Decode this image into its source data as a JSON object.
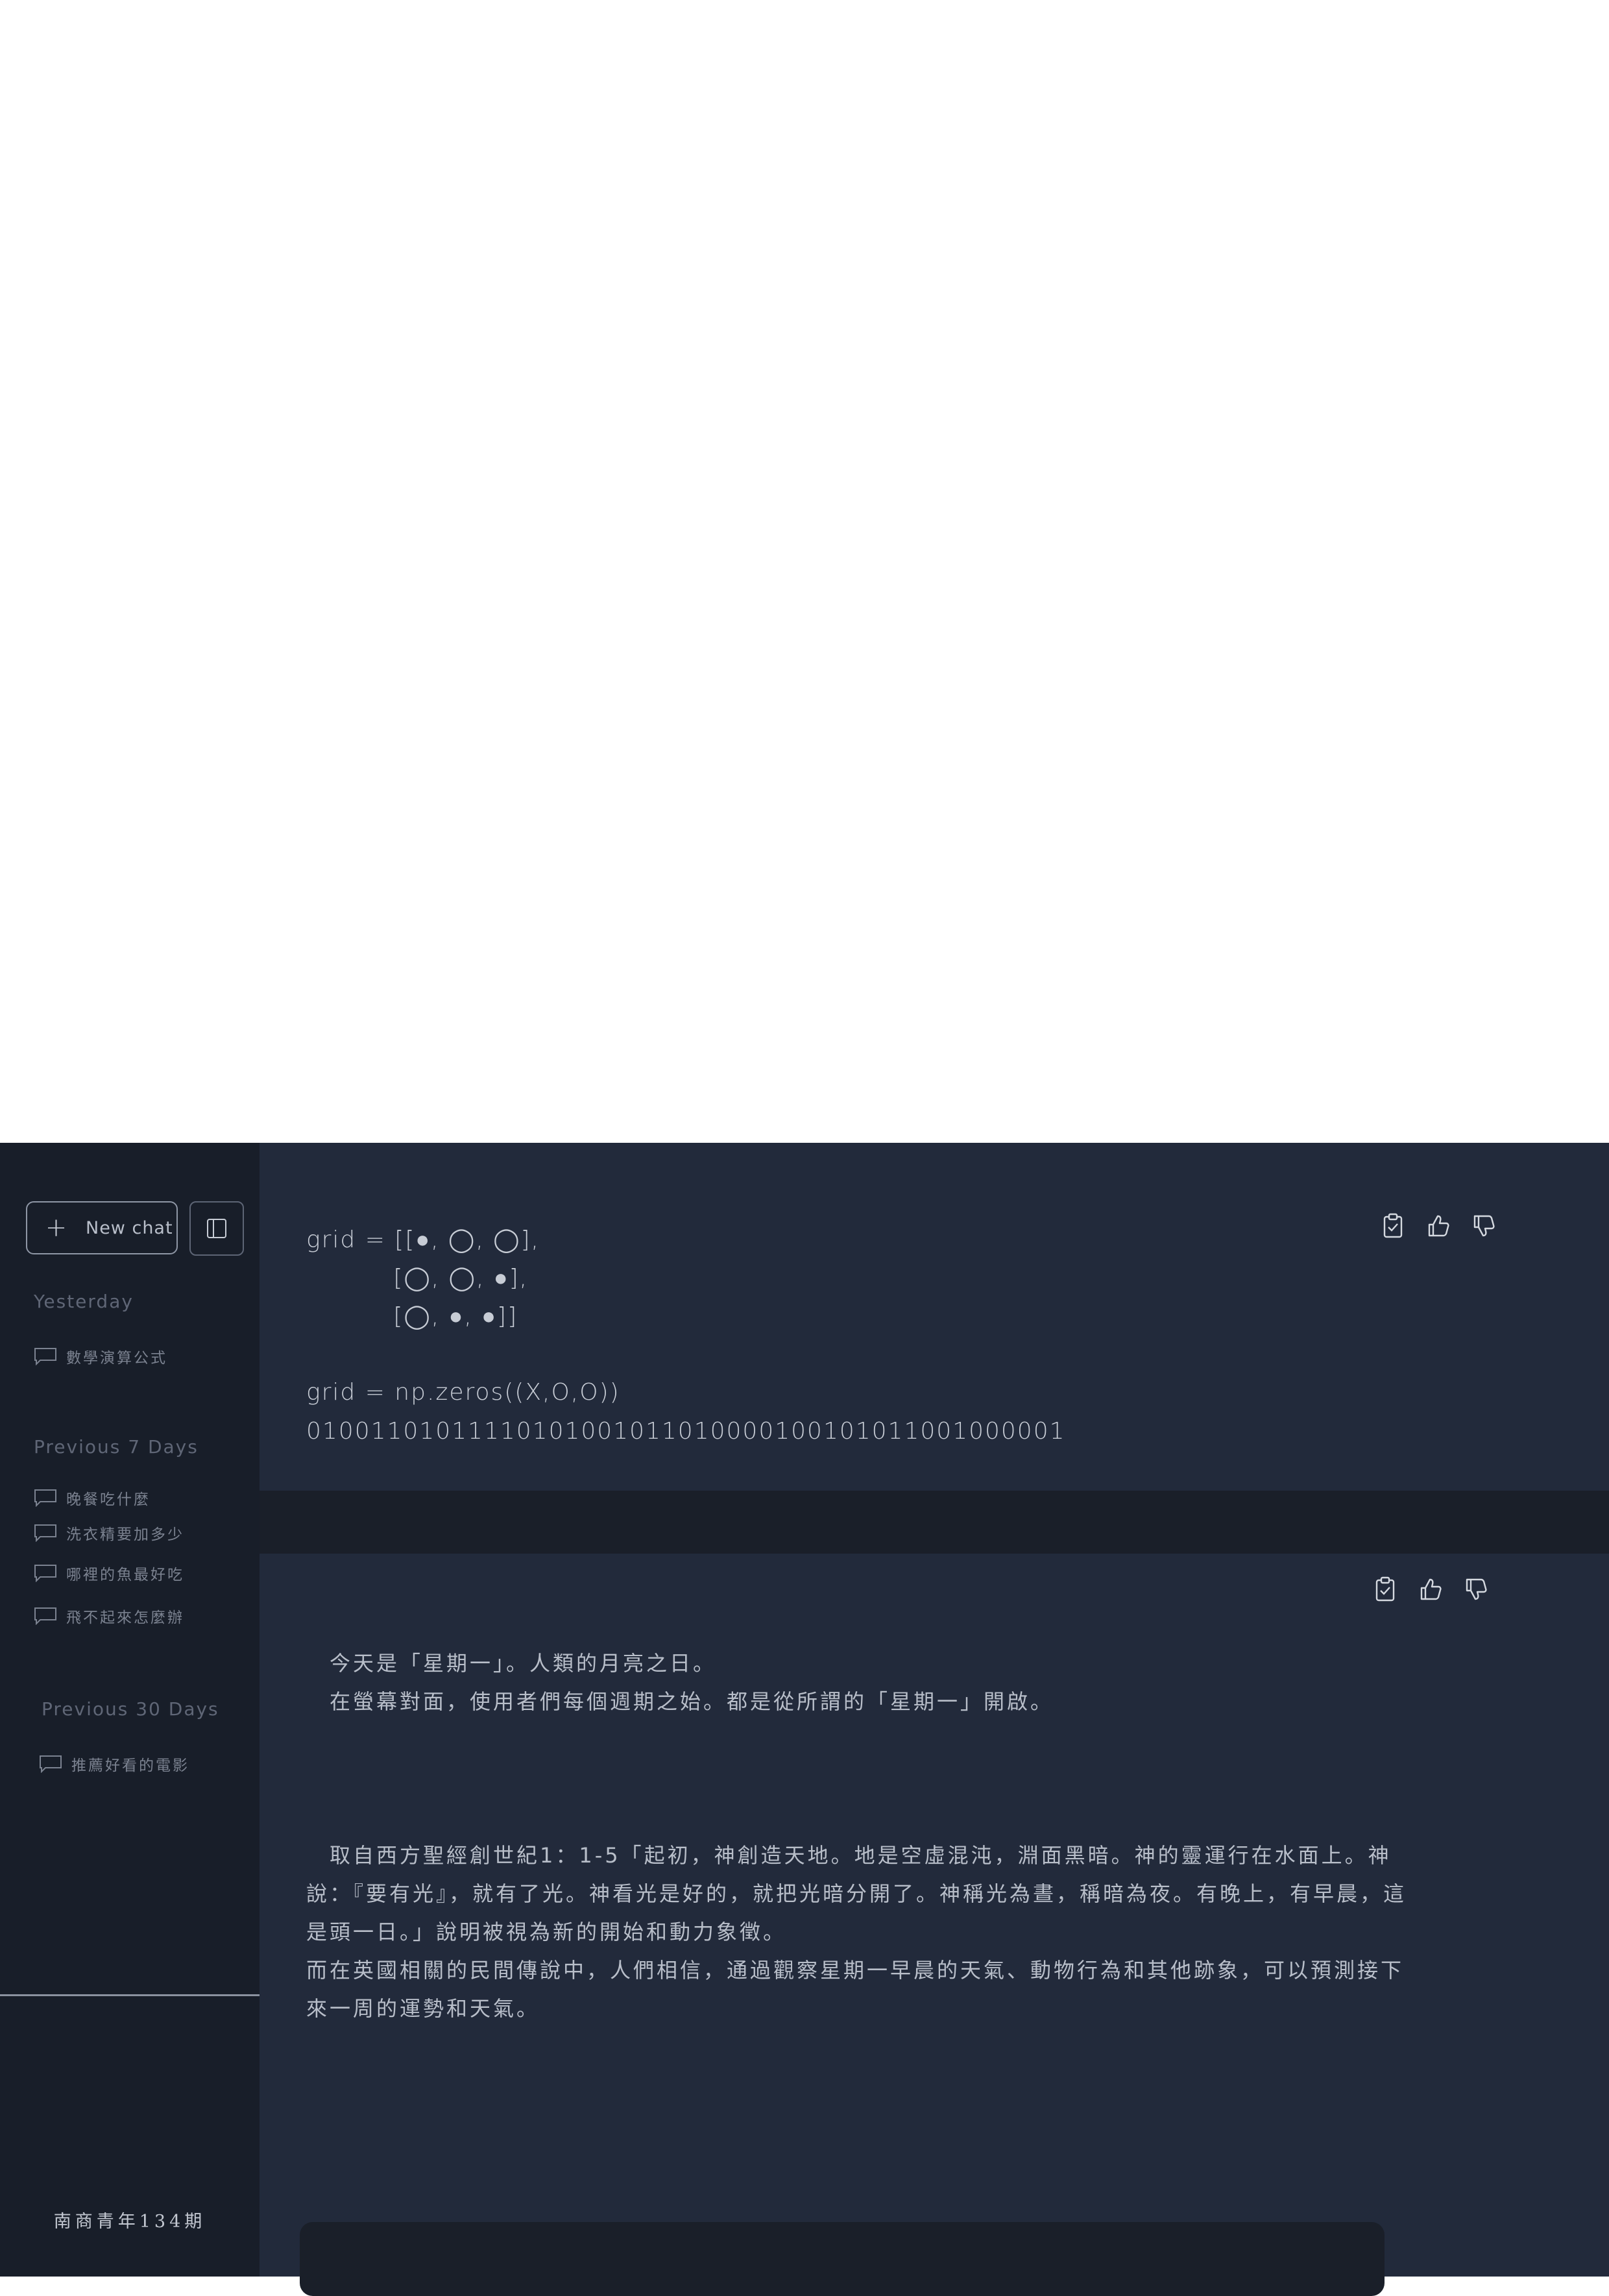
{
  "sidebar": {
    "new_chat_label": "New chat",
    "sections": [
      {
        "label": "Yesterday",
        "items": [
          "數學演算公式"
        ]
      },
      {
        "label": "Previous 7 Days",
        "items": [
          "晚餐吃什麼",
          "洗衣精要加多少",
          "哪裡的魚最好吃",
          "飛不起來怎麼辦"
        ]
      },
      {
        "label": "Previous 30 Days",
        "items": [
          "推薦好看的電影"
        ]
      }
    ],
    "footer": "南商青年134期"
  },
  "messages": [
    {
      "lines": [
        "grid = [[●, ◯, ◯],",
        "          [◯, ◯, ●],",
        "          [◯, ●, ●]]",
        "grid = np.zeros((X,O,O))",
        "01001101011110101001011010000100101011001000001"
      ]
    },
    {
      "intro": [
        "今天是「星期一」。人類的月亮之日。",
        "在螢幕對面，使用者們每個週期之始。都是從所謂的「星期一」開啟。"
      ],
      "body": [
        "取自西方聖經創世紀1：1-5「起初，神創造天地。地是空虛混沌，淵面黑暗。神的靈運行在水面上。神說：『要有光』，就有了光。神看光是好的，就把光暗分開了。神稱光為晝，稱暗為夜。有晚上，有早晨，這是頭一日。」說明被視為新的開始和動力象徵。",
        "而在英國相關的民間傳說中，人們相信，通過觀察星期一早晨的天氣、動物行為和其他跡象，可以預測接下來一周的運勢和天氣。"
      ]
    }
  ],
  "icons": [
    "plus-icon",
    "sidebar-toggle-icon",
    "chat-bubble-icon",
    "clipboard-check-icon",
    "thumbs-up-icon",
    "thumbs-down-icon"
  ]
}
